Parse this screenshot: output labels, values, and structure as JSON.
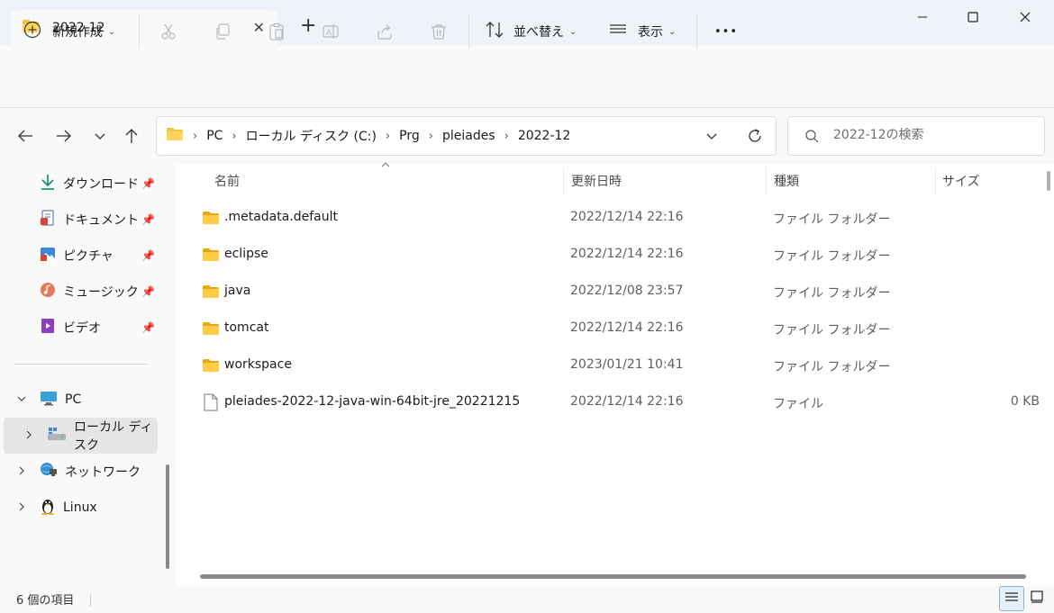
{
  "window": {
    "tab_title": "2022-12",
    "new_tab": "+",
    "close_tab": "✕",
    "minimize": "—",
    "maximize": "☐",
    "close": "✕"
  },
  "toolbar": {
    "new_label": "新規作成",
    "sort_label": "並べ替え",
    "view_label": "表示",
    "more_label": "•••"
  },
  "address": {
    "crumbs": [
      "PC",
      "ローカル ディスク (C:)",
      "Prg",
      "pleiades",
      "2022-12"
    ],
    "search_placeholder": "2022-12の検索"
  },
  "sidebar": {
    "quick": [
      {
        "label": "ダウンロード",
        "icon": "download-icon"
      },
      {
        "label": "ドキュメント",
        "icon": "documents-icon"
      },
      {
        "label": "ピクチャ",
        "icon": "pictures-icon"
      },
      {
        "label": "ミュージック",
        "icon": "music-icon"
      },
      {
        "label": "ビデオ",
        "icon": "video-icon"
      }
    ],
    "tree": [
      {
        "label": "PC",
        "icon": "pc-icon"
      },
      {
        "label": "ローカル ディスク",
        "icon": "local-disk-icon"
      },
      {
        "label": "ネットワーク",
        "icon": "network-icon"
      },
      {
        "label": "Linux",
        "icon": "linux-icon"
      }
    ]
  },
  "columns": {
    "name": "名前",
    "modified": "更新日時",
    "type": "種類",
    "size": "サイズ"
  },
  "files": [
    {
      "name": ".metadata.default",
      "modified": "2022/12/14 22:16",
      "type": "ファイル フォルダー",
      "size": "",
      "kind": "folder"
    },
    {
      "name": "eclipse",
      "modified": "2022/12/14 22:16",
      "type": "ファイル フォルダー",
      "size": "",
      "kind": "folder"
    },
    {
      "name": "java",
      "modified": "2022/12/08 23:57",
      "type": "ファイル フォルダー",
      "size": "",
      "kind": "folder"
    },
    {
      "name": "tomcat",
      "modified": "2022/12/14 22:16",
      "type": "ファイル フォルダー",
      "size": "",
      "kind": "folder"
    },
    {
      "name": "workspace",
      "modified": "2023/01/21 10:41",
      "type": "ファイル フォルダー",
      "size": "",
      "kind": "folder"
    },
    {
      "name": "pleiades-2022-12-java-win-64bit-jre_20221215",
      "modified": "2022/12/14 22:16",
      "type": "ファイル",
      "size": "0 KB",
      "kind": "file"
    }
  ],
  "status": {
    "item_count": "6 個の項目"
  },
  "colors": {
    "folder": "#f5c342",
    "accent": "#0067c0",
    "selected_bg": "#e5e5e5"
  }
}
